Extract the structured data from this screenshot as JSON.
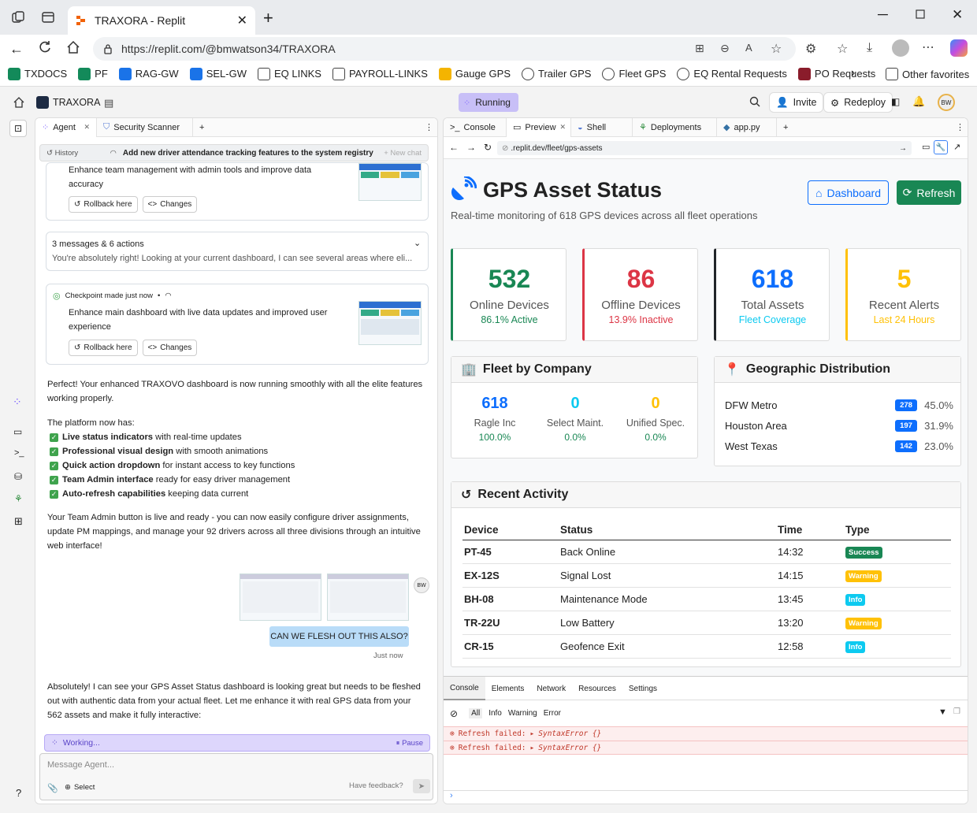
{
  "browser": {
    "tab_title": "TRAXORA - Replit",
    "url": "https://replit.com/@bmwatson34/TRAXORA",
    "url_display": "https://replit.com/@bmwatson34/TRAXORA"
  },
  "favorites": [
    "TXDOCS",
    "PF",
    "RAG-GW",
    "SEL-GW",
    "EQ LINKS",
    "PAYROLL-LINKS",
    "Gauge GPS",
    "Trailer GPS",
    "Fleet GPS",
    "EQ Rental Requests",
    "PO Requests"
  ],
  "favorites_other": "Other favorites",
  "replit": {
    "project": "TRAXORA",
    "status": "Running",
    "invite": "Invite",
    "redeploy": "Redeploy",
    "avatar": "BW"
  },
  "agent_panel": {
    "tabs": [
      "Agent",
      "Security Scanner"
    ],
    "history_label": "History",
    "history_title": "Add new driver attendance tracking features to the system registry",
    "new_chat": "New chat",
    "card1_text": "Enhance team management with admin tools and improve data accuracy",
    "rollback": "Rollback here",
    "changes": "Changes",
    "collapsed_title": "3 messages & 6 actions",
    "collapsed_preview": "You're absolutely right! Looking at your current dashboard, I can see several areas where eli...",
    "checkpoint_label": "Checkpoint made just now",
    "card2_text": "Enhance main dashboard with live data updates and improved user experience",
    "msg1": "Perfect! Your enhanced TRAXOVO dashboard is now running smoothly with all the elite features working properly.",
    "platform_has": "The platform now has:",
    "features": [
      {
        "bold": "Live status indicators",
        "rest": " with real-time updates"
      },
      {
        "bold": "Professional visual design",
        "rest": " with smooth animations"
      },
      {
        "bold": "Quick action dropdown",
        "rest": " for instant access to key functions"
      },
      {
        "bold": "Team Admin interface",
        "rest": " ready for easy driver management"
      },
      {
        "bold": "Auto-refresh capabilities",
        "rest": " keeping data current"
      }
    ],
    "msg2": "Your Team Admin button is live and ready - you can now easily configure driver assignments, update PM mappings, and manage your 92 drivers across all three divisions through an intuitive web interface!",
    "user_msg": "CAN WE FLESH OUT THIS ALSO?",
    "user_time": "Just now",
    "user_avatar": "BW",
    "msg3": "Absolutely! I can see your GPS Asset Status dashboard is looking great but needs to be fleshed out with authentic data from your actual fleet. Let me enhance it with real GPS data from your 562 assets and make it fully interactive:",
    "working": "Working...",
    "pause": "Pause",
    "input_placeholder": "Message Agent...",
    "select": "Select",
    "feedback": "Have feedback?"
  },
  "preview_panel": {
    "tabs": [
      "Console",
      "Preview",
      "Shell",
      "Deployments",
      "app.py"
    ],
    "address": ".replit.dev/fleet/gps-assets"
  },
  "site": {
    "title": "GPS Asset Status",
    "subtitle": "Real-time monitoring of 618 GPS devices across all fleet operations",
    "dashboard_btn": "Dashboard",
    "refresh_btn": "Refresh",
    "stats": [
      {
        "num": "532",
        "label": "Online Devices",
        "sub": "86.1% Active",
        "color": "#198754"
      },
      {
        "num": "86",
        "label": "Offline Devices",
        "sub": "13.9% Inactive",
        "color": "#dc3545"
      },
      {
        "num": "618",
        "label": "Total Assets",
        "sub": "Fleet Coverage",
        "color": "#0d6efd"
      },
      {
        "num": "5",
        "label": "Recent Alerts",
        "sub": "Last 24 Hours",
        "color": "#ffc107"
      }
    ],
    "fleet_title": "Fleet by Company",
    "fleet": [
      {
        "num": "618",
        "name": "Ragle Inc",
        "pct": "100.0%",
        "color": "#0d6efd"
      },
      {
        "num": "0",
        "name": "Select Maint.",
        "pct": "0.0%",
        "color": "#0dcaf0"
      },
      {
        "num": "0",
        "name": "Unified Spec.",
        "pct": "0.0%",
        "color": "#ffc107"
      }
    ],
    "geo_title": "Geographic Distribution",
    "geo": [
      {
        "name": "DFW Metro",
        "count": "278",
        "pct": "45.0%"
      },
      {
        "name": "Houston Area",
        "count": "197",
        "pct": "31.9%"
      },
      {
        "name": "West Texas",
        "count": "142",
        "pct": "23.0%"
      }
    ],
    "activity_title": "Recent Activity",
    "activity_headers": [
      "Device",
      "Status",
      "Time",
      "Type"
    ],
    "activity": [
      {
        "device": "PT-45",
        "status": "Back Online",
        "time": "14:32",
        "type": "Success",
        "color": "#198754",
        "fg": "#fff"
      },
      {
        "device": "EX-12S",
        "status": "Signal Lost",
        "time": "14:15",
        "type": "Warning",
        "color": "#ffc107",
        "fg": "#fff"
      },
      {
        "device": "BH-08",
        "status": "Maintenance Mode",
        "time": "13:45",
        "type": "Info",
        "color": "#0dcaf0",
        "fg": "#fff"
      },
      {
        "device": "TR-22U",
        "status": "Low Battery",
        "time": "13:20",
        "type": "Warning",
        "color": "#ffc107",
        "fg": "#fff"
      },
      {
        "device": "CR-15",
        "status": "Geofence Exit",
        "time": "12:58",
        "type": "Info",
        "color": "#0dcaf0",
        "fg": "#fff"
      }
    ]
  },
  "devtools": {
    "tabs": [
      "Console",
      "Elements",
      "Network",
      "Resources",
      "Settings"
    ],
    "filters": [
      "All",
      "Info",
      "Warning",
      "Error"
    ],
    "errors": [
      "Refresh failed:",
      "Refresh failed:"
    ],
    "error_type": "SyntaxError {}"
  }
}
